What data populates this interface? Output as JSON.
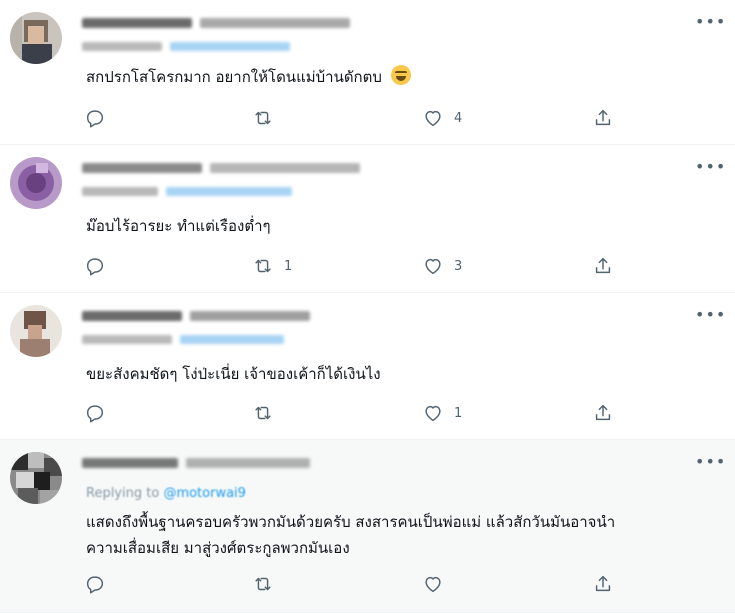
{
  "tweets": [
    {
      "text": "สกปรกโสโครกมาก อยากให้โดนแม่บ้านดักตบ",
      "emoji": "grinning-squinting-face",
      "reply_label": "",
      "reply_handle": "",
      "reply_count": "",
      "retweet_count": "",
      "like_count": "4"
    },
    {
      "text": "ม๊อบไร้อารยะ ทำแต่เรืองต่ำๆ",
      "emoji": "",
      "reply_label": "",
      "reply_handle": "",
      "reply_count": "",
      "retweet_count": "1",
      "like_count": "3"
    },
    {
      "text": "ขยะสังคมชัดๆ  โง่ป่ะเนี่ย เจ้าของเค้าก็ได้เงินไง",
      "emoji": "",
      "reply_label": "",
      "reply_handle": "",
      "reply_count": "",
      "retweet_count": "",
      "like_count": "1"
    },
    {
      "text_line1": "แสดงถึงพื้นฐานครอบครัวพวกมันด้วยครับ สงสารคนเป็นพ่อแม่ แล้วสักวันมันอาจนำ",
      "text_line2": "ความเสื่อมเสีย มาสู่วงศ์ตระกูลพวกมันเอง",
      "emoji": "",
      "reply_label": "Replying to",
      "reply_handle": "@motorwai9",
      "reply_count": "",
      "retweet_count": "",
      "like_count": ""
    }
  ],
  "more_glyph": "•••",
  "colors": {
    "text": "#0f1419",
    "muted": "#536471",
    "accent": "#1d9bf0",
    "divider": "#eff3f4"
  },
  "icons": [
    "reply-icon",
    "retweet-icon",
    "like-icon",
    "share-icon",
    "more-icon"
  ]
}
